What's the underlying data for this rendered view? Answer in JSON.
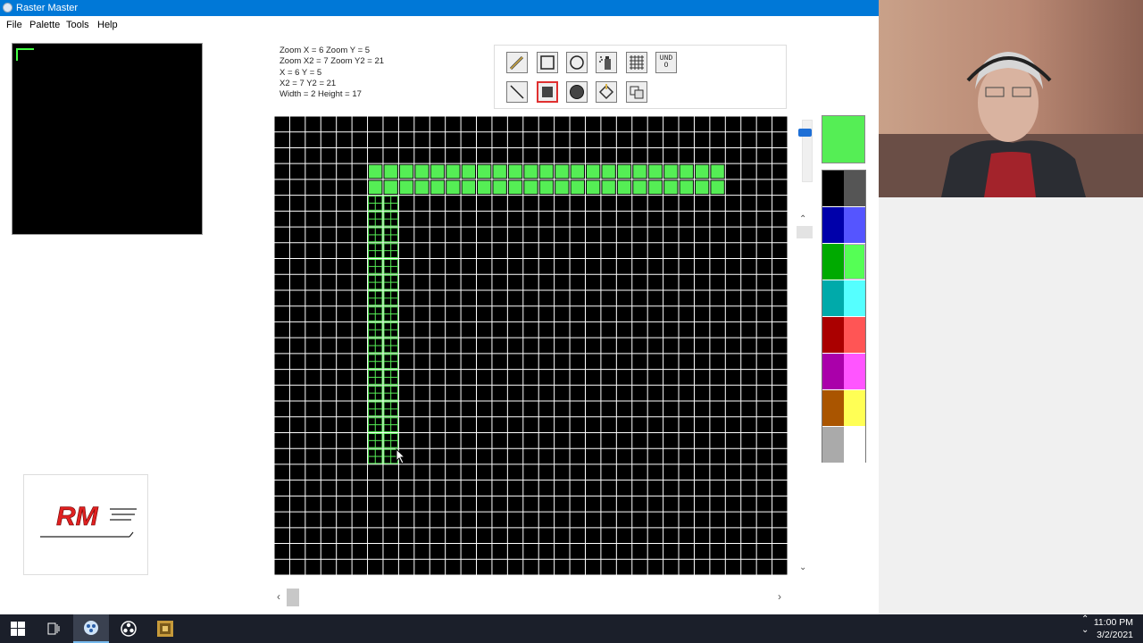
{
  "window": {
    "title": "Raster Master"
  },
  "menu": [
    "File",
    "Palette",
    "Tools",
    "Help"
  ],
  "info_lines": [
    "Zoom X = 6 Zoom Y = 5",
    "Zoom X2 = 7 Zoom Y2 = 21",
    "X = 6 Y = 5",
    "X2 = 7 Y2 = 21",
    "Width = 2 Height = 17"
  ],
  "toolbar": {
    "row1": [
      "pencil-icon",
      "rectangle-outline-icon",
      "circle-outline-icon",
      "paint-spray-icon",
      "grid-icon",
      "undo-icon"
    ],
    "row2": [
      "line-icon",
      "filled-rectangle-icon",
      "filled-circle-icon",
      "fill-bucket-icon",
      "select-copy-icon"
    ],
    "undo_label": "UNDO",
    "selected_tool": "filled-rectangle-icon"
  },
  "grid": {
    "cols": 33,
    "rows": 29,
    "line_color": "#ffffff",
    "background": "#000000",
    "filled_rows": [
      3,
      4
    ],
    "filled_col_start": 6,
    "filled_col_end": 28,
    "selection": {
      "col_start": 6,
      "col_end": 7,
      "row_start": 5,
      "row_end": 21
    }
  },
  "colors": {
    "current": "#55ee55",
    "swatches": [
      [
        "#000000",
        "#555555"
      ],
      [
        "#0000aa",
        "#5555ff"
      ],
      [
        "#00aa00",
        "#55ff55"
      ],
      [
        "#00aaaa",
        "#55ffff"
      ],
      [
        "#aa0000",
        "#ff5555"
      ],
      [
        "#aa00aa",
        "#ff55ff"
      ],
      [
        "#aa5500",
        "#ffff55"
      ],
      [
        "#aaaaaa",
        "#ffffff"
      ]
    ],
    "selected_swatch": "#55ff55"
  },
  "logo": {
    "text": "RM"
  },
  "taskbar": {
    "time": "11:00 PM",
    "date": "3/2/2021",
    "apps": [
      "windows-start-icon",
      "task-view-icon",
      "raster-master-icon",
      "obs-icon",
      "dosbox-icon"
    ]
  }
}
